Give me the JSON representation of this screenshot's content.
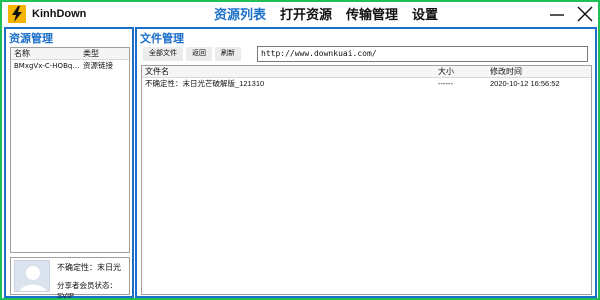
{
  "app": {
    "name": "KinhDown",
    "nav": [
      "资源列表",
      "打开资源",
      "传输管理",
      "设置"
    ]
  },
  "left": {
    "title": "资源管理",
    "columns": {
      "name": "名称",
      "type": "类型"
    },
    "rows": [
      {
        "name": "BMxgVx-C-HOBq…",
        "type": "资源链接"
      }
    ],
    "user": {
      "line1": "不确定性：末日光",
      "line2": "分享者会员状态：SVIP"
    }
  },
  "right": {
    "title": "文件管理",
    "buttons": {
      "all": "全部文件",
      "back": "返回",
      "refresh": "刷新"
    },
    "path": "http://www.downkuai.com/",
    "columns": {
      "name": "文件名",
      "size": "大小",
      "time": "修改时间"
    },
    "rows": [
      {
        "name": "不确定性：末日光芒破解版_121310",
        "size": "------",
        "time": "2020-10-12 16:56:52"
      }
    ]
  },
  "colors": {
    "frame": "#1fbf5a",
    "accent": "#1a6fc9"
  },
  "icons": {
    "logo": "lightning-logo-icon",
    "minimize": "minimize-icon",
    "close": "close-icon",
    "avatar": "user-avatar-icon"
  }
}
